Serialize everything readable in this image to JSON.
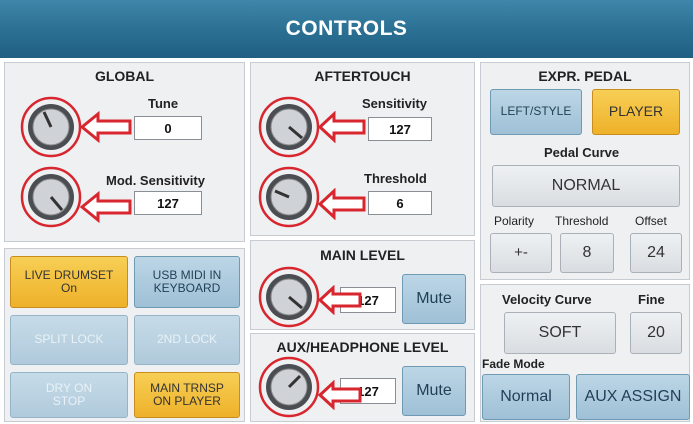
{
  "header": {
    "title": "CONTROLS"
  },
  "global": {
    "title": "GLOBAL",
    "tune_label": "Tune",
    "tune_value": "0",
    "mod_label": "Mod. Sensitivity",
    "mod_value": "127"
  },
  "aftertouch": {
    "title": "AFTERTOUCH",
    "sensitivity_label": "Sensitivity",
    "sensitivity_value": "127",
    "threshold_label": "Threshold",
    "threshold_value": "6"
  },
  "main_level": {
    "title": "MAIN LEVEL",
    "value": "127",
    "mute_label": "Mute"
  },
  "aux_level": {
    "title": "AUX/HEADPHONE LEVEL",
    "value": "127",
    "mute_label": "Mute"
  },
  "buttons": {
    "live_drumset": "LIVE DRUMSET",
    "live_drumset_state": "On",
    "usb_midi_line1": "USB MIDI IN",
    "usb_midi_line2": "KEYBOARD",
    "split_lock": "SPLIT LOCK",
    "second_lock": "2ND LOCK",
    "dry_on_stop_line1": "DRY ON",
    "dry_on_stop_line2": "STOP",
    "main_trnsp_line1": "MAIN TRNSP",
    "main_trnsp_line2": "ON PLAYER"
  },
  "expr_pedal": {
    "title": "EXPR. PEDAL",
    "left_style": "LEFT/STYLE",
    "player": "PLAYER",
    "pedal_curve_label": "Pedal Curve",
    "pedal_curve_value": "NORMAL",
    "polarity_label": "Polarity",
    "threshold_label": "Threshold",
    "offset_label": "Offset",
    "polarity_value": "+-",
    "threshold_value": "8",
    "offset_value": "24"
  },
  "velocity": {
    "curve_label": "Velocity Curve",
    "fine_label": "Fine",
    "curve_value": "SOFT",
    "fine_value": "20"
  },
  "fade": {
    "label": "Fade Mode",
    "mode_value": "Normal",
    "aux_assign": "AUX ASSIGN"
  },
  "colors": {
    "title_bar": "#2a6f92",
    "highlight_ring": "#d8262f",
    "active_button": "#eeb12a",
    "button_blue": "#9fc0d6"
  }
}
